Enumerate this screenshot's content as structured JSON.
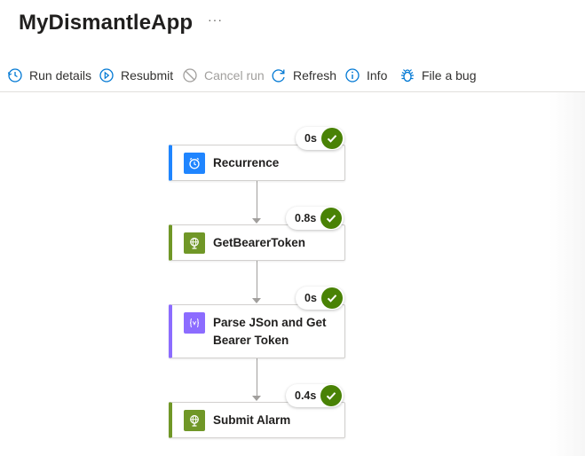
{
  "app": {
    "title": "MyDismantleApp",
    "more_label": "···"
  },
  "toolbar": {
    "run_details": "Run details",
    "resubmit": "Resubmit",
    "cancel_run": "Cancel run",
    "refresh": "Refresh",
    "info": "Info",
    "file_bug": "File a bug"
  },
  "steps": [
    {
      "label": "Recurrence",
      "duration": "0s",
      "status": "succeeded",
      "icon": "clock-icon",
      "accent": "#1f85ff"
    },
    {
      "label": "GetBearerToken",
      "duration": "0.8s",
      "status": "succeeded",
      "icon": "globe-icon",
      "accent": "#709727"
    },
    {
      "label": "Parse JSon and Get Bearer Token",
      "duration": "0s",
      "status": "succeeded",
      "icon": "variable-icon",
      "accent": "#8c6cff"
    },
    {
      "label": "Submit Alarm",
      "duration": "0.4s",
      "status": "succeeded",
      "icon": "globe-icon",
      "accent": "#709727"
    }
  ],
  "colors": {
    "success": "#498205",
    "brand": "#0078d4"
  }
}
